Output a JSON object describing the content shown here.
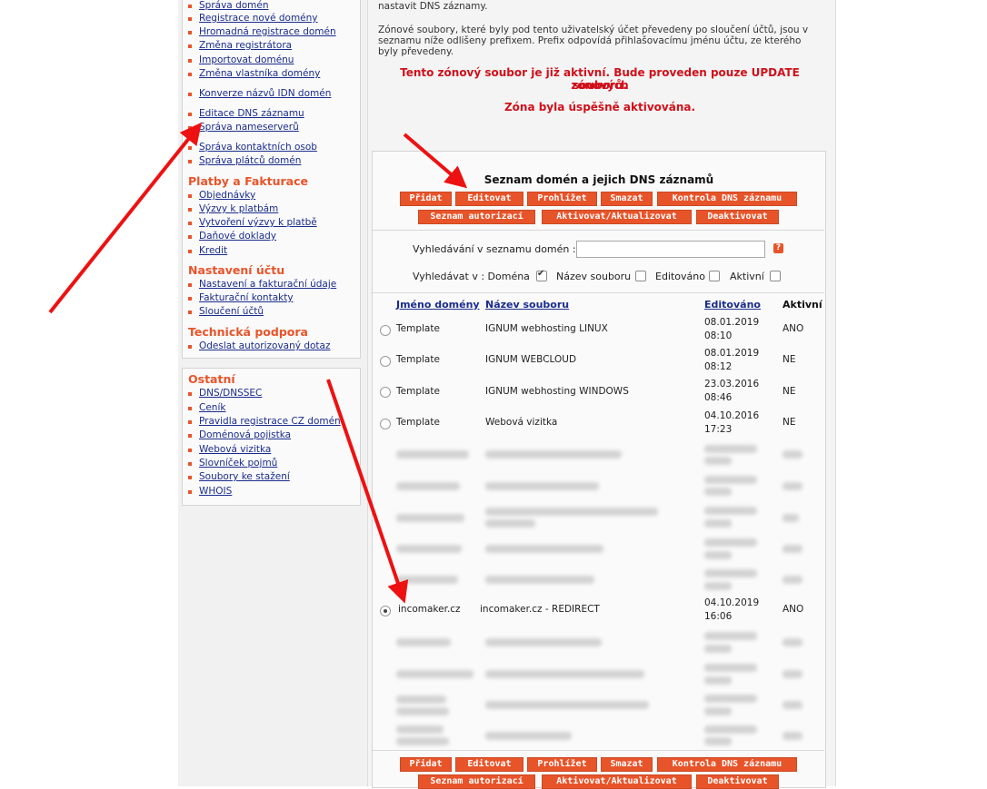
{
  "sidebar": {
    "menu1": [
      {
        "label": "Správa domén"
      },
      {
        "label": "Registrace nové domény"
      },
      {
        "label": "Hromadná registrace domén"
      },
      {
        "label": "Změna registrátora"
      },
      {
        "label": "Importovat doménu"
      },
      {
        "label": "Změna vlastníka domény"
      },
      {
        "label": "Konverze názvů IDN domén"
      },
      {
        "label": "Editace DNS záznamu"
      },
      {
        "label": "Správa nameserverů"
      },
      {
        "label": "Správa kontaktních osob"
      },
      {
        "label": "Správa plátců domén"
      }
    ],
    "payments_heading": "Platby a Fakturace",
    "payments": [
      {
        "label": "Objednávky"
      },
      {
        "label": "Výzvy k platbám"
      },
      {
        "label": "Vytvoření výzvy k platbě"
      },
      {
        "label": "Daňové doklady"
      },
      {
        "label": "Kredit"
      }
    ],
    "account_heading": "Nastavení účtu",
    "account": [
      {
        "label": "Nastavení a fakturační údaje"
      },
      {
        "label": "Fakturační kontakty"
      },
      {
        "label": "Sloučení účtů"
      }
    ],
    "support_heading": "Technická podpora",
    "support": [
      {
        "label": "Odeslat autorizovaný dotaz"
      }
    ],
    "other_heading": "Ostatní",
    "other": [
      {
        "label": "DNS/DNSSEC"
      },
      {
        "label": "Ceník"
      },
      {
        "label": "Pravidla registrace CZ domén"
      },
      {
        "label": "Doménová pojistka"
      },
      {
        "label": "Webová vizitka"
      },
      {
        "label": "Slovníček pojmů"
      },
      {
        "label": "Soubory ke stažení"
      },
      {
        "label": "WHOIS"
      }
    ]
  },
  "main": {
    "intro_line0": "nastavit DNS záznamy.",
    "intro_line1": "Zónové soubory, které byly pod tento uživatelský účet převedeny po sloučení účtů, jsou v",
    "intro_line2": "seznamu níže odlišeny prefixem. Prefix odpovídá přihlašovacímu jménu účtu, ze kterého",
    "intro_line3": "byly převedeny.",
    "alert_line1": "Tento zónový soubor je již aktivní. Bude proveden pouze UPDATE zónových",
    "alert_line2": "souborů.",
    "alert_success": "Zóna byla úspěšně aktivována.",
    "panel_title": "Seznam domén a jejich DNS záznamů",
    "buttons": {
      "add": "Přidat",
      "edit": "Editovat",
      "browse": "Prohlížet",
      "delete": "Smazat",
      "check": "Kontrola DNS záznamu",
      "authorizations": "Seznam autorizací",
      "activate": "Aktivovat/Aktualizovat",
      "deactivate": "Deaktivovat"
    },
    "search": {
      "label": "Vyhledávání v seznamu domén   :",
      "value": "",
      "help": "?"
    },
    "filters": {
      "label": "Vyhledávat v   : Doména",
      "domain_checked": true,
      "file_label": "Název souboru",
      "edited_label": "Editováno",
      "active_label": "Aktivní"
    },
    "table": {
      "headers": [
        "Jméno domény",
        "Název souboru",
        "Editováno",
        "Aktivní"
      ],
      "rows": [
        {
          "domain": "Template",
          "file": "IGNUM webhosting LINUX",
          "date": "08.01.2019",
          "time": "08:10",
          "active": "ANO"
        },
        {
          "domain": "Template",
          "file": "IGNUM WEBCLOUD",
          "date": "08.01.2019",
          "time": "08:12",
          "active": "NE"
        },
        {
          "domain": "Template",
          "file": "IGNUM webhosting WINDOWS",
          "date": "23.03.2016",
          "time": "08:46",
          "active": "NE"
        },
        {
          "domain": "Template",
          "file": "Webová vizitka",
          "date": "04.10.2016",
          "time": "17:23",
          "active": "NE"
        }
      ],
      "selected_row": {
        "domain": "incomaker.cz",
        "file": "incomaker.cz - REDIRECT",
        "date": "04.10.2019",
        "time": "16:06",
        "active": "ANO"
      }
    }
  },
  "colors": {
    "accent": "#e8542a",
    "alert": "#d0101a",
    "link": "#1a2c8c",
    "arrow": "#ee1111"
  }
}
